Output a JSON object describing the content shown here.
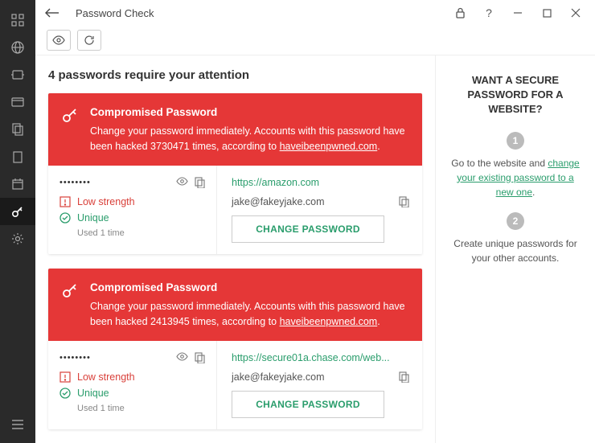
{
  "titlebar": {
    "title": "Password Check"
  },
  "content": {
    "attention": "4 passwords require your attention",
    "cards": [
      {
        "title": "Compromised Password",
        "desc_pre": "Change your password immediately. Accounts with this password have been hacked 3730471 times, according to ",
        "source": "haveibeenpwned.com",
        "password_mask": "••••••••",
        "strength": "Low strength",
        "unique": "Unique",
        "used": "Used 1 time",
        "url": "https://amazon.com",
        "email": "jake@fakeyjake.com",
        "button": "CHANGE PASSWORD"
      },
      {
        "title": "Compromised Password",
        "desc_pre": "Change your password immediately. Accounts with this password have been hacked 2413945 times, according to ",
        "source": "haveibeenpwned.com",
        "password_mask": "••••••••",
        "strength": "Low strength",
        "unique": "Unique",
        "used": "Used 1 time",
        "url": "https://secure01a.chase.com/web...",
        "email": "jake@fakeyjake.com",
        "button": "CHANGE PASSWORD"
      }
    ]
  },
  "rpanel": {
    "title": "WANT A SECURE PASSWORD FOR A WEBSITE?",
    "step1_num": "1",
    "step1_pre": "Go to the website and ",
    "step1_link": "change your existing password to a new one",
    "step1_post": ".",
    "step2_num": "2",
    "step2_text": "Create unique passwords for your other accounts."
  }
}
